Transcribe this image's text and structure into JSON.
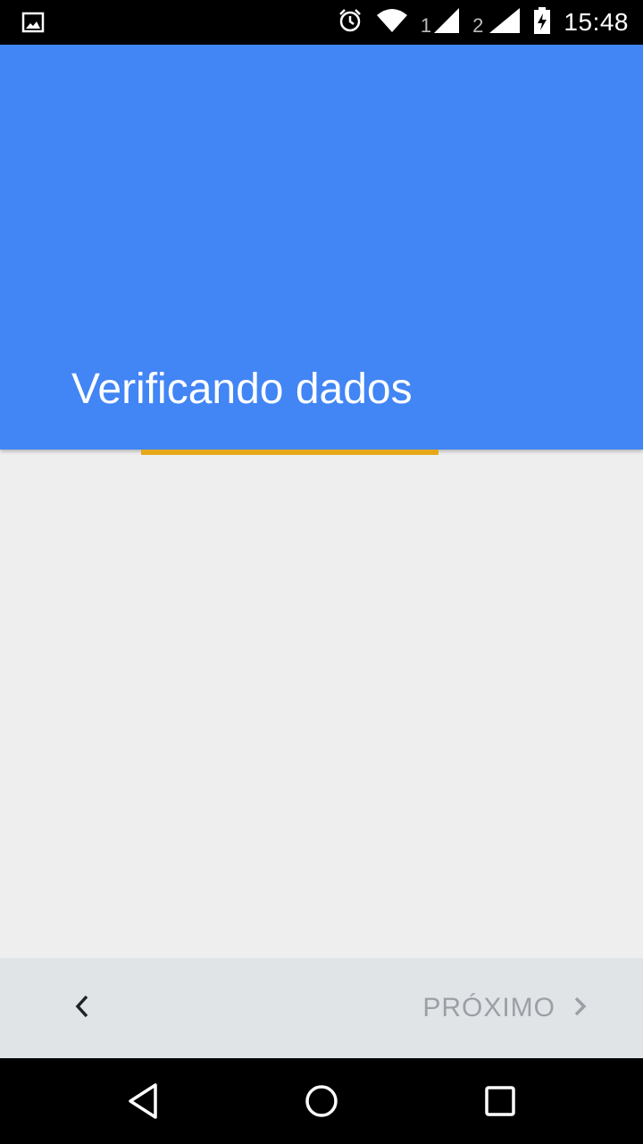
{
  "status_bar": {
    "time": "15:48",
    "sim1": "1",
    "sim2": "2",
    "icons": [
      "image-icon",
      "alarm-icon",
      "wifi-icon",
      "signal-icon",
      "battery-charging-icon"
    ]
  },
  "header": {
    "title": "Verificando dados",
    "background": "#4285f4"
  },
  "progress": {
    "color": "#e6a819"
  },
  "action_bar": {
    "back_icon": "chevron-left-icon",
    "next_label": "PRÓXIMO",
    "next_icon": "chevron-right-icon"
  },
  "nav_bar": {
    "icons": [
      "back-triangle-icon",
      "home-circle-icon",
      "recents-square-icon"
    ]
  }
}
